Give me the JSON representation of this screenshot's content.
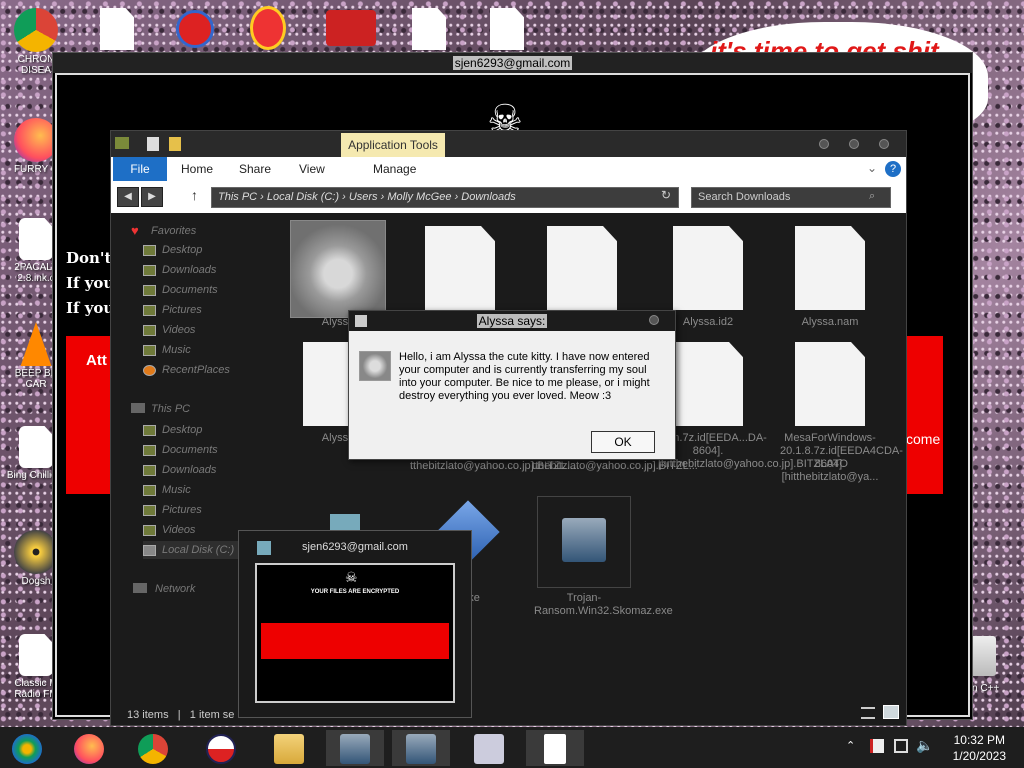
{
  "desktop": {
    "icons_left": [
      {
        "label": "CHRON DISEA"
      },
      {
        "label": "FURRY C"
      },
      {
        "label": "2PACALY 2.8.ink.c"
      },
      {
        "label": "BEEP BE CAR"
      },
      {
        "label": "Bing Chilling."
      },
      {
        "label": "Dogsh"
      },
      {
        "label": "Classic M Radio FM"
      }
    ],
    "icon_right_label": "n C++",
    "meme_text": "it's time to get shit",
    "meme_te": "te"
  },
  "ransom_window": {
    "title": "sjen6293@gmail.com",
    "lines": [
      "Don't",
      "If you",
      "If you"
    ],
    "attention": "Att",
    "come": "come"
  },
  "explorer": {
    "app_tools": "Application Tools",
    "tabs": {
      "file": "File",
      "home": "Home",
      "share": "Share",
      "view": "View",
      "manage": "Manage"
    },
    "address": [
      "This PC",
      "Local Disk (C:)",
      "Users",
      "Molly McGee",
      "Downloads"
    ],
    "search_placeholder": "Search Downloads",
    "nav": {
      "favorites": "Favorites",
      "fav_items": [
        "Desktop",
        "Downloads",
        "Documents",
        "Pictures",
        "Videos",
        "Music",
        "RecentPlaces"
      ],
      "this_pc": "This PC",
      "pc_items": [
        "Desktop",
        "Documents",
        "Downloads",
        "Music",
        "Pictures",
        "Videos",
        "Local Disk (C:)"
      ],
      "network": "Network"
    },
    "files": {
      "f1": "Alyssa",
      "f4": "Alyssa.id2",
      "f5": "Alyssa.nam",
      "f6": "Alyssa",
      "f7": "tthebitzlato@yahoo.co.jp].BITZL...",
      "f8": "tthebitzlato@yahoo.co.jp].BITZL...",
      "f9": "...en.7z.id[EEDA...DA-8604].[hitthebitzlato@yahoo.co.jp].BITZLATO",
      "f10": "MesaForWindows-20.1.8.7z.id[EEDA4CDA-8604].[hitthebitzlato@ya...",
      "f11": "ke",
      "f12": "Trojan-Ransom.Win32.Skomaz.exe"
    },
    "status": {
      "count": "13 items",
      "selected": "1 item se"
    }
  },
  "dialog": {
    "title": "Alyssa says:",
    "message": "Hello, i am Alyssa the cute kitty. I have now entered your computer and is currently transferring my soul into your computer. Be nice to me please, or i might destroy everything you ever loved. Meow :3",
    "ok": "OK"
  },
  "thumbnail": {
    "title": "sjen6293@gmail.com",
    "heading": "YOUR FILES ARE ENCRYPTED"
  },
  "taskbar": {
    "time": "10:32 PM",
    "date": "1/20/2023"
  },
  "colors": {
    "accent": "#1e6fc6",
    "ransom_red": "#e00000",
    "meme_red": "#e01818"
  }
}
